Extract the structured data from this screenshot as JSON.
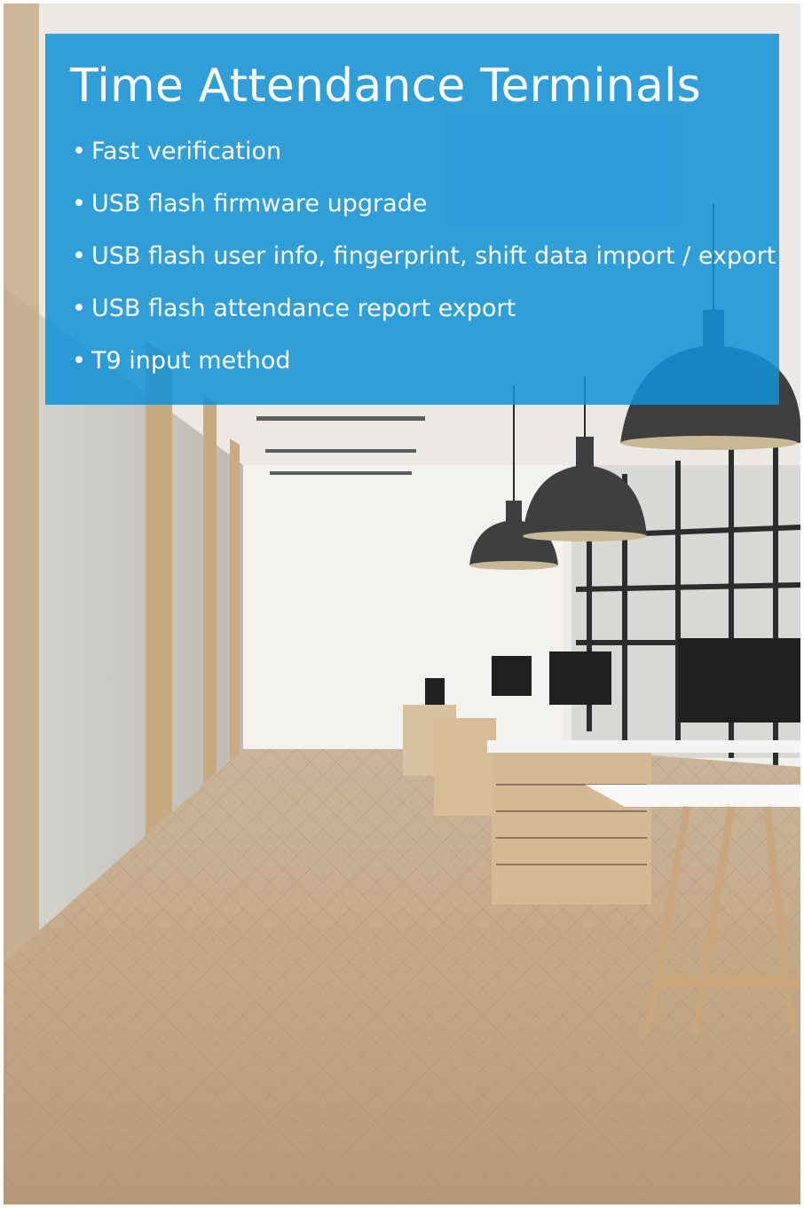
{
  "slide": {
    "title": "Time Attendance Terminals",
    "bullets": [
      "Fast verification",
      "USB flash firmware upgrade",
      "USB flash user info, fingerprint, shift data import / export",
      "USB flash attendance report export",
      "T9 input method"
    ],
    "bullet_glyph": "•"
  },
  "colors": {
    "overlay": "#1e96d6",
    "text": "#ffffff",
    "floor": "#c9ad8a",
    "lamp": "#3d3f41"
  }
}
